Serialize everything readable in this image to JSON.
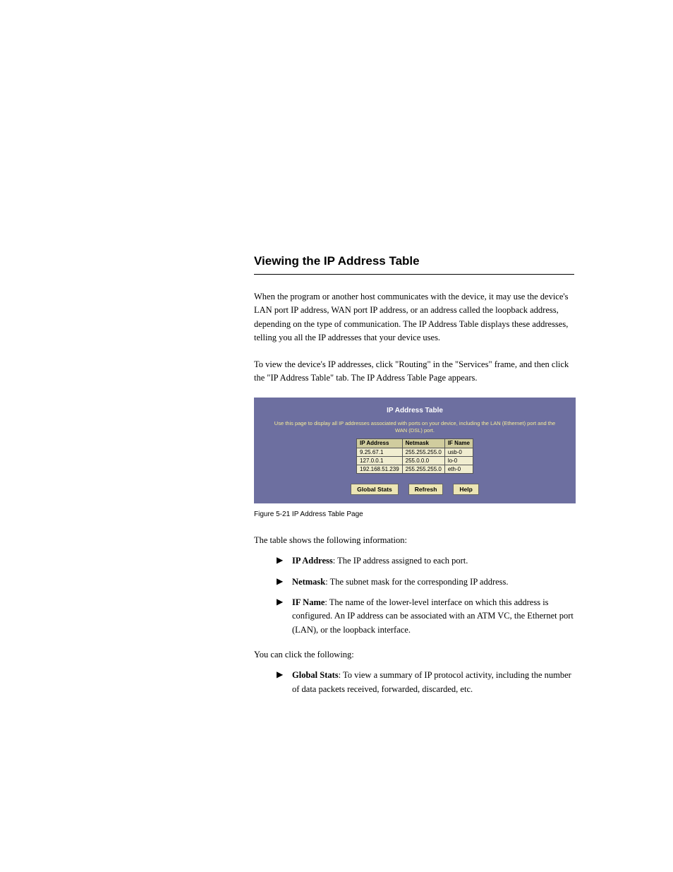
{
  "section": {
    "title": "Viewing the IP Address Table"
  },
  "intro_paragraph": "When the program or another host communicates with the device, it may use the device's LAN port IP address, WAN port IP address, or an address called the loopback address, depending on the type of communication. The IP Address Table displays these addresses, telling you all the IP addresses that your device uses.",
  "to_view": "To view the device's IP addresses, click \"Routing\" in the \"Services\" frame, and then click the \"IP Address Table\" tab. The IP Address Table Page appears.",
  "figure": {
    "panel_title": "IP Address Table",
    "panel_desc": "Use this page to display all IP addresses associated with ports on your device, including the LAN (Ethernet) port and the WAN (DSL) port.",
    "columns": [
      "IP Address",
      "Netmask",
      "IF Name"
    ],
    "rows": [
      {
        "ip": "9.25.67.1",
        "mask": "255.255.255.0",
        "ifname": "usb-0"
      },
      {
        "ip": "127.0.0.1",
        "mask": "255.0.0.0",
        "ifname": "lo-0"
      },
      {
        "ip": "192.168.51.239",
        "mask": "255.255.255.0",
        "ifname": "eth-0"
      }
    ],
    "buttons": {
      "global_stats": "Global Stats",
      "refresh": "Refresh",
      "help": "Help"
    },
    "caption": "Figure 5-21  IP Address Table Page"
  },
  "list_intro": "The table shows the following information:",
  "bullets": [
    {
      "term": "IP Address",
      "desc": ": The IP address assigned to each port."
    },
    {
      "term": "Netmask",
      "desc": ": The subnet mask for the corresponding IP address."
    },
    {
      "term": "IF Name",
      "desc": ": The name of the lower-level interface on which this address is configured. An IP address can be associated with an ATM VC, the Ethernet port (LAN), or the loopback interface."
    }
  ],
  "action_intro": "You can click the following:",
  "actions": [
    {
      "term": "Global Stats",
      "desc": ": To view a summary of IP protocol activity, including the number of data packets received, forwarded, discarded, etc."
    }
  ]
}
